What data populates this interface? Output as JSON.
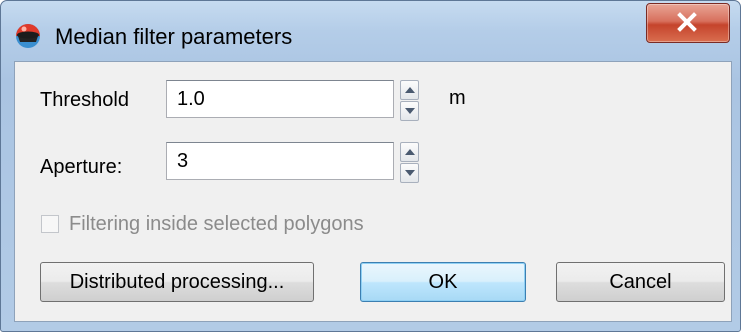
{
  "window": {
    "title": "Median filter parameters",
    "icon": "colored-sphere-icon",
    "close_symbol": "X"
  },
  "form": {
    "threshold": {
      "label": "Threshold",
      "value": "1.0",
      "unit": "m"
    },
    "aperture": {
      "label": "Aperture:",
      "value": "3"
    },
    "filter_polygons": {
      "label": "Filtering inside selected polygons",
      "checked": false,
      "enabled": false
    }
  },
  "buttons": {
    "distributed": "Distributed processing...",
    "ok": "OK",
    "cancel": "Cancel"
  },
  "colors": {
    "titlebar": "#b4cde8",
    "client_bg": "#f0f0f0",
    "close_button": "#c5442c",
    "default_button": "#bee6fd",
    "disabled_text": "#8b8b8b"
  }
}
